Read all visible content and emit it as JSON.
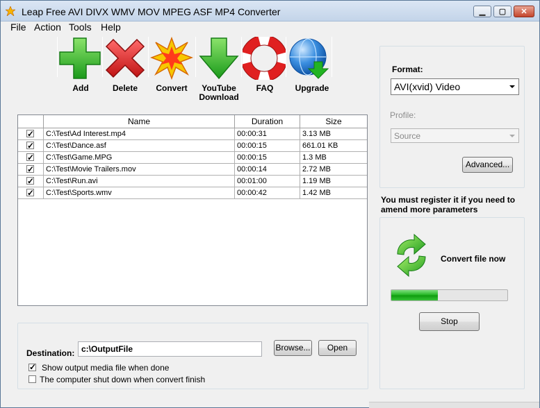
{
  "window": {
    "title": "Leap Free AVI DIVX WMV MOV MPEG ASF MP4 Converter",
    "minimize": "▁",
    "maximize": "▢",
    "close": "✕"
  },
  "menu": [
    "File",
    "Action",
    "Tools",
    "Help"
  ],
  "toolbar": {
    "add": "Add",
    "delete": "Delete",
    "convert": "Convert",
    "youtube_line1": "YouTube",
    "youtube_line2": "Download",
    "faq": "FAQ",
    "upgrade": "Upgrade"
  },
  "file_list": {
    "columns": [
      "",
      "Name",
      "Duration",
      "Size"
    ],
    "rows": [
      {
        "checked": true,
        "name": "C:\\Test\\Ad Interest.mp4",
        "duration": "00:00:31",
        "size": "3.13 MB"
      },
      {
        "checked": true,
        "name": "C:\\Test\\Dance.asf",
        "duration": "00:00:15",
        "size": "661.01 KB"
      },
      {
        "checked": true,
        "name": "C:\\Test\\Game.MPG",
        "duration": "00:00:15",
        "size": "1.3 MB"
      },
      {
        "checked": true,
        "name": "C:\\Test\\Movie Trailers.mov",
        "duration": "00:00:14",
        "size": "2.72 MB"
      },
      {
        "checked": true,
        "name": "C:\\Test\\Run.avi",
        "duration": "00:01:00",
        "size": "1.19 MB"
      },
      {
        "checked": true,
        "name": "C:\\Test\\Sports.wmv",
        "duration": "00:00:42",
        "size": "1.42 MB"
      }
    ]
  },
  "destination": {
    "label": "Destination:",
    "value": "c:\\OutputFile",
    "browse": "Browse...",
    "open": "Open",
    "show_output_label": "Show output media file when done",
    "show_output_checked": true,
    "shutdown_label": "The computer shut down when convert finish",
    "shutdown_checked": false
  },
  "settings": {
    "format_label": "Format:",
    "format_value": "AVI(xvid) Video",
    "profile_label": "Profile:",
    "profile_value": "Source",
    "advanced": "Advanced..."
  },
  "register_note": "You must register it if you need to amend more parameters",
  "convert_panel": {
    "label": "Convert file now",
    "progress": 0.4,
    "stop": "Stop"
  },
  "colors": {
    "accent_green": "#1fb41f",
    "delete_red": "#d81e1e",
    "window_bg": "#f0f0f0"
  }
}
